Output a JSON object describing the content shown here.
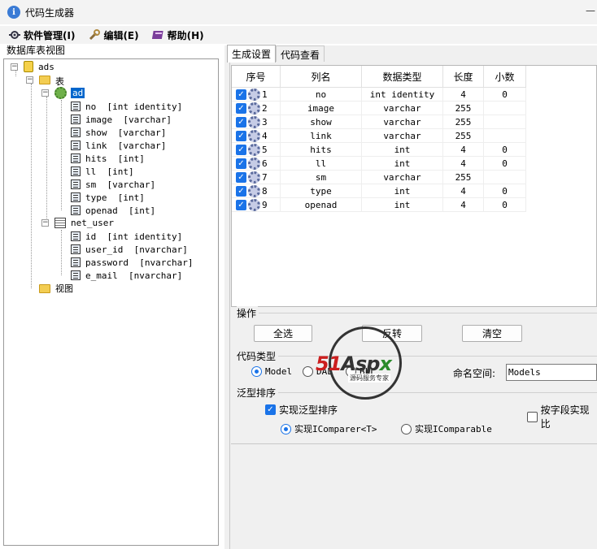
{
  "window": {
    "title": "代码生成器",
    "minimize": "—"
  },
  "menu": [
    {
      "label": "软件管理(I)"
    },
    {
      "label": "编辑(E)"
    },
    {
      "label": "帮助(H)"
    }
  ],
  "left_panel": {
    "label": "数据库表视图",
    "tree": {
      "db": "ads",
      "tables_folder": "表",
      "views_folder": "视图",
      "tables": [
        {
          "name": "ad",
          "columns": [
            "no  [int identity]",
            "image  [varchar]",
            "show  [varchar]",
            "link  [varchar]",
            "hits  [int]",
            "ll  [int]",
            "sm  [varchar]",
            "type  [int]",
            "openad  [int]"
          ]
        },
        {
          "name": "net_user",
          "columns": [
            "id  [int identity]",
            "user_id  [nvarchar]",
            "password  [nvarchar]",
            "e_mail  [nvarchar]"
          ]
        }
      ]
    }
  },
  "tabs": [
    {
      "label": "生成设置",
      "active": true
    },
    {
      "label": "代码查看",
      "active": false
    }
  ],
  "grid": {
    "headers": [
      "序号",
      "列名",
      "数据类型",
      "长度",
      "小数"
    ],
    "rows": [
      {
        "idx": "1",
        "name": "no",
        "type": "int identity",
        "len": "4",
        "dec": "0",
        "checked": true
      },
      {
        "idx": "2",
        "name": "image",
        "type": "varchar",
        "len": "255",
        "dec": "",
        "checked": true
      },
      {
        "idx": "3",
        "name": "show",
        "type": "varchar",
        "len": "255",
        "dec": "",
        "checked": true
      },
      {
        "idx": "4",
        "name": "link",
        "type": "varchar",
        "len": "255",
        "dec": "",
        "checked": true
      },
      {
        "idx": "5",
        "name": "hits",
        "type": "int",
        "len": "4",
        "dec": "0",
        "checked": true
      },
      {
        "idx": "6",
        "name": "ll",
        "type": "int",
        "len": "4",
        "dec": "0",
        "checked": true
      },
      {
        "idx": "7",
        "name": "sm",
        "type": "varchar",
        "len": "255",
        "dec": "",
        "checked": true
      },
      {
        "idx": "8",
        "name": "type",
        "type": "int",
        "len": "4",
        "dec": "0",
        "checked": true
      },
      {
        "idx": "9",
        "name": "openad",
        "type": "int",
        "len": "4",
        "dec": "0",
        "checked": true
      }
    ]
  },
  "operations": {
    "label": "操作",
    "select_all": "全选",
    "invert": "反转",
    "clear": "清空"
  },
  "code_type": {
    "label": "代码类型",
    "options": [
      "Model",
      "DAL",
      "BLL"
    ],
    "selected": "Model",
    "namespace_label": "命名空间:",
    "namespace_value": "Models"
  },
  "generic_sort": {
    "label": "泛型排序",
    "enable_label": "实现泛型排序",
    "enable_checked": true,
    "by_field_label": "按字段实现比",
    "by_field_checked": false,
    "icomparer_label": "实现IComparer<T>",
    "icomparable_label": "实现IComparable",
    "selected": "IComparer"
  },
  "watermark": {
    "brand": "51Aspx",
    "subtitle": "源码服务专家"
  },
  "colors": {
    "accent": "#1a73e8",
    "selection": "#0066cc",
    "folder": "#f3cd52"
  }
}
